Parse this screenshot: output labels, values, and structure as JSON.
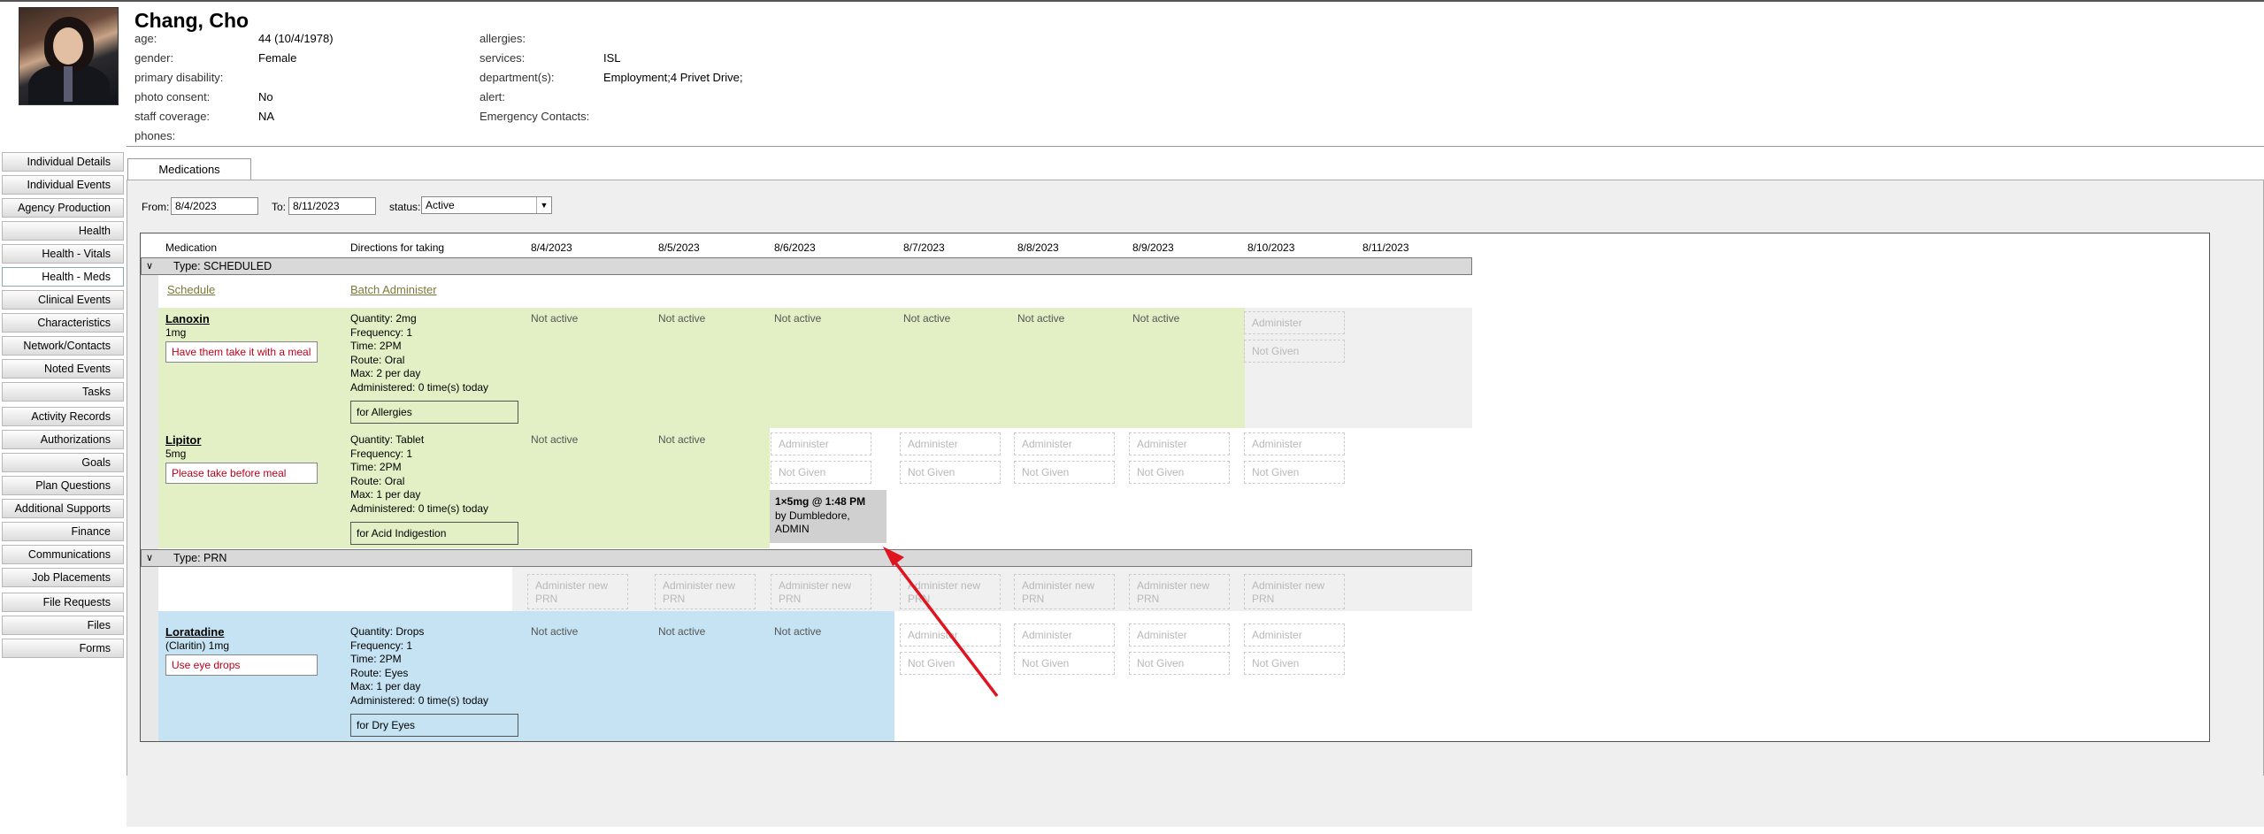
{
  "patient": {
    "name": "Chang, Cho",
    "left_fields": [
      {
        "label": "age:",
        "value": "44 (10/4/1978)"
      },
      {
        "label": "gender:",
        "value": "Female"
      },
      {
        "label": "primary disability:",
        "value": ""
      },
      {
        "label": "photo consent:",
        "value": "No"
      },
      {
        "label": "staff coverage:",
        "value": "NA"
      },
      {
        "label": "phones:",
        "value": ""
      }
    ],
    "right_fields": [
      {
        "label": "allergies:",
        "value": ""
      },
      {
        "label": "services:",
        "value": "ISL"
      },
      {
        "label": "department(s):",
        "value": "Employment;4 Privet Drive;"
      },
      {
        "label": "alert:",
        "value": ""
      },
      {
        "label": "Emergency Contacts:",
        "value": ""
      }
    ]
  },
  "sidebar": {
    "items": [
      {
        "label": "Individual Details"
      },
      {
        "label": "Individual Events"
      },
      {
        "label": "Agency Production"
      },
      {
        "label": "Health"
      },
      {
        "label": "Health - Vitals"
      },
      {
        "label": "Health - Meds"
      },
      {
        "label": "Clinical Events"
      },
      {
        "label": "Characteristics"
      },
      {
        "label": "Network/Contacts"
      },
      {
        "label": "Noted Events"
      },
      {
        "label": "Tasks"
      },
      {
        "label": "Activity Records"
      },
      {
        "label": "Authorizations"
      },
      {
        "label": "Goals"
      },
      {
        "label": "Plan Questions"
      },
      {
        "label": "Additional Supports"
      },
      {
        "label": "Finance"
      },
      {
        "label": "Communications"
      },
      {
        "label": "Job Placements"
      },
      {
        "label": "File Requests"
      },
      {
        "label": "Files"
      },
      {
        "label": "Forms"
      }
    ],
    "active": "Health - Meds"
  },
  "tab": {
    "label": "Medications"
  },
  "filters": {
    "from_label": "From:",
    "from_value": "8/4/2023",
    "to_label": "To:",
    "to_value": "8/11/2023",
    "status_label": "status:",
    "status_value": "Active"
  },
  "grid": {
    "col_medication": "Medication",
    "col_directions": "Directions for taking",
    "dates": [
      "8/4/2023",
      "8/5/2023",
      "8/6/2023",
      "8/7/2023",
      "8/8/2023",
      "8/9/2023",
      "8/10/2023",
      "8/11/2023"
    ],
    "type_scheduled": "Type: SCHEDULED",
    "type_prn": "Type: PRN",
    "schedule_link": "Schedule",
    "batch_link": "Batch Administer",
    "not_active": "Not active",
    "administer": "Administer",
    "not_given": "Not Given",
    "administer_prn": "Administer new PRN",
    "meds": [
      {
        "name": "Lanoxin",
        "dose": "1mg",
        "note": "Have them take it with a meal",
        "directions": "Quantity: 2mg\nFrequency: 1\nTime: 2PM\nRoute: Oral\nMax: 2 per day\nAdministered: 0 time(s) today",
        "for": "for Allergies"
      },
      {
        "name": "Lipitor",
        "dose": "5mg",
        "note": "Please take before meal",
        "directions": "Quantity: Tablet\nFrequency: 1\nTime: 2PM\nRoute: Oral\nMax: 1 per day\nAdministered: 0 time(s) today",
        "for": "for Acid Indigestion",
        "given_line1": "1×5mg @ 1:48 PM",
        "given_line2": "by Dumbledore,",
        "given_line3": "ADMIN"
      },
      {
        "name": "Loratadine",
        "dose": "(Claritin) 1mg",
        "note": "Use eye drops",
        "directions": "Quantity: Drops\nFrequency: 1\nTime: 2PM\nRoute: Eyes\nMax: 1 per day\nAdministered: 0 time(s) today",
        "for": "for Dry Eyes"
      }
    ]
  },
  "colors": {
    "scheduled_bg": "#e3f0c5",
    "prn_bg": "#c5e3f3",
    "note_text": "#c0001a",
    "arrow": "#e0141e"
  }
}
